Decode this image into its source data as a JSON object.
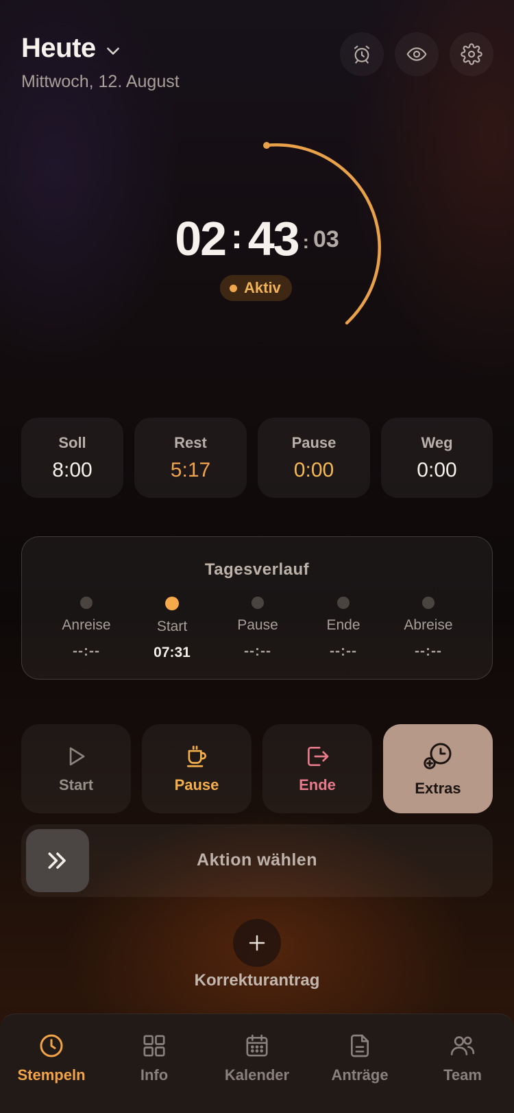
{
  "header": {
    "title": "Heute",
    "date": "Mittwoch, 12. August",
    "icons": [
      "alarm-icon",
      "eye-icon",
      "gear-icon"
    ]
  },
  "timer": {
    "hours": "02",
    "minutes": "43",
    "seconds": "03",
    "status": "Aktiv",
    "accent": "#f2a34c"
  },
  "stats": [
    {
      "label": "Soll",
      "value": "8:00"
    },
    {
      "label": "Rest",
      "value": "5:17"
    },
    {
      "label": "Pause",
      "value": "0:00"
    },
    {
      "label": "Weg",
      "value": "0:00"
    }
  ],
  "timeline": {
    "title": "Tagesverlauf",
    "steps": [
      {
        "label": "Anreise",
        "time": "--:--"
      },
      {
        "label": "Start",
        "time": "07:31"
      },
      {
        "label": "Pause",
        "time": "--:--"
      },
      {
        "label": "Ende",
        "time": "--:--"
      },
      {
        "label": "Abreise",
        "time": "--:--"
      }
    ]
  },
  "actions": {
    "start": "Start",
    "pause": "Pause",
    "ende": "Ende",
    "extras": "Extras"
  },
  "slider": {
    "label": "Aktion wählen"
  },
  "correction": {
    "label": "Korrekturantrag"
  },
  "nav": {
    "items": [
      {
        "label": "Stempeln",
        "icon": "clock-icon"
      },
      {
        "label": "Info",
        "icon": "grid-icon"
      },
      {
        "label": "Kalender",
        "icon": "calendar-icon"
      },
      {
        "label": "Anträge",
        "icon": "document-icon"
      },
      {
        "label": "Team",
        "icon": "team-icon"
      }
    ],
    "active": "Stempeln"
  }
}
